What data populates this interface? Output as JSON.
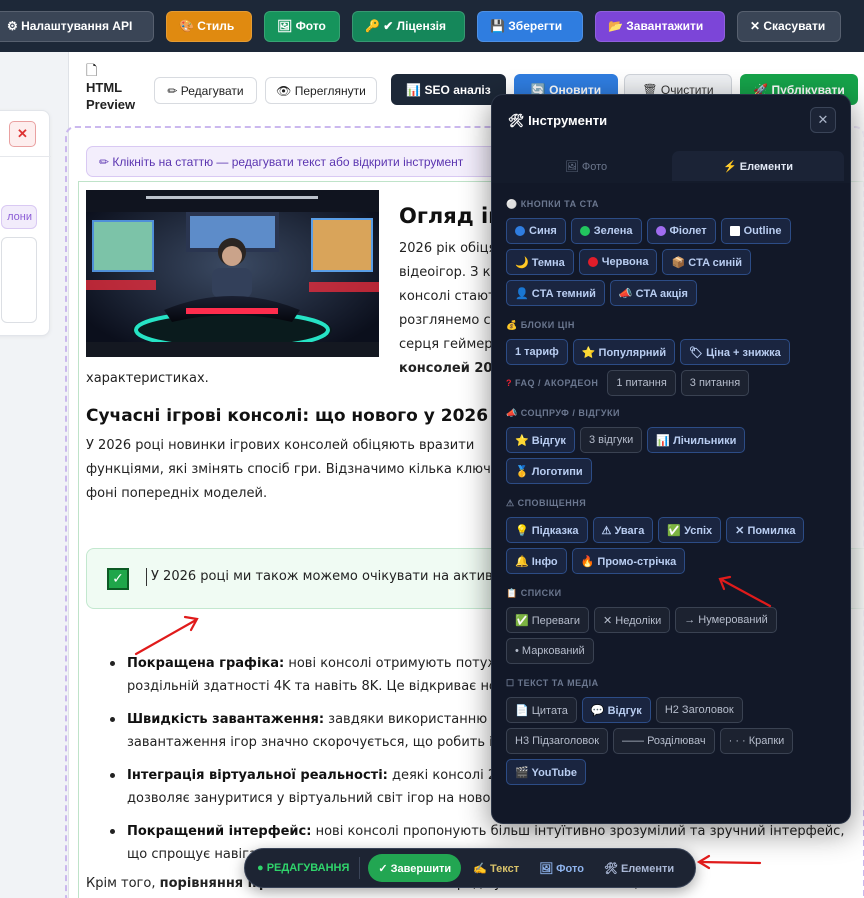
{
  "topbar": {
    "api": "⚙ Налаштування API",
    "style": "🎨 Стиль",
    "photo": "🖼 Фото",
    "license": "🔑 ✔ Ліцензія",
    "save": "💾 Зберегти",
    "load": "📂 Завантажити",
    "cancel": "✕ Скасувати"
  },
  "leftpanel": {
    "close": "✕",
    "pill": "лони"
  },
  "preview": {
    "title_line1": "HTML",
    "title_line2": "Preview",
    "edit": "✏ Редагувати",
    "view": "👁 Переглянути",
    "seo": "📊 SEO аналіз",
    "update": "🔄 Оновити",
    "clear": "🗑 Очистити",
    "publish": "🚀 Публікувати",
    "hint": "✏ Клікніть на статтю — редагувати текст або відкрити інструмент"
  },
  "article": {
    "h1": "Огляд іг",
    "intro": [
      "2026 рік обіця",
      "відеоігор. З ко",
      "консолі стают",
      "розглянемо с",
      "серця геймер",
      "консолей 202"
    ],
    "intro_cont": "характеристиках.",
    "h2": "Сучасні ігрові консолі: що нового у 2026 ро",
    "p1": [
      "У 2026 році новинки ігрових консолей обіцяють вразити",
      "функціями, які змінять спосіб гри. Відзначимо кілька ключо",
      "фоні попередніх моделей."
    ],
    "callout": "У 2026 році ми також можемо очікувати на активн",
    "bullets": [
      {
        "title": "Покращена графіка:",
        "line1": " нові консолі отримують потужн",
        "line2": "роздільній здатності 4K та навіть 8K. Це відкриває нов"
      },
      {
        "title": "Швидкість завантаження:",
        "line1": " завдяки використанню т",
        "line2": "завантаження ігор значно скорочується, що робить і"
      },
      {
        "title": "Інтеграція віртуальної реальності:",
        "line1": " деякі консолі 20",
        "line2": "дозволяє зануритися у віртуальний світ ігор на новом"
      },
      {
        "title": "Покращений інтерфейс:",
        "line1": " нові консолі пропонують більш інтуїтивно зрозумілий та зручний інтерфейс,",
        "line2": "що спрощує навіга"
      }
    ],
    "last_a": "Крім того, ",
    "last_b": "порівняння ігрових",
    "last_c": "                              ",
    "last_d": "зосереджуються на оптимізації"
  },
  "tools": {
    "title": "🛠 Інструменти",
    "close": "✕",
    "tab_photo": "🖼 Фото",
    "tab_elements": "⚡ Елементи",
    "sec_buttons": "КНОПКИ ТА CTA",
    "btn_blue": "Синя",
    "btn_green": "Зелена",
    "btn_violet": "Фіолет",
    "btn_outline": "Outline",
    "btn_dark": "🌙 Темна",
    "btn_red": "Червона",
    "btn_cta_blue": "📦 CTA синій",
    "btn_cta_dark": "👤 CTA темний",
    "btn_cta_promo": "📣 CTA акція",
    "sec_prices": "БЛОКИ ЦІН",
    "price_1": "1 тариф",
    "price_popular": "⭐ Популярний",
    "price_discount": "🏷 Ціна + знижка",
    "sec_faq": "FAQ / АКОРДЕОН",
    "faq_1": "1 питання",
    "faq_3": "3 питання",
    "sec_social": "СОЦПРУФ / ВІДГУКИ",
    "soc_review": "⭐ Відгук",
    "soc_3reviews": "3 відгуки",
    "soc_counters": "📊 Лічильники",
    "soc_logos": "🥇 Логотипи",
    "sec_notices": "СПОВІЩЕННЯ",
    "n_tip": "💡 Підказка",
    "n_warn": "⚠ Увага",
    "n_success": "✅ Успіх",
    "n_error": "✕ Помилка",
    "n_info": "🔔 Інфо",
    "n_promo": "🔥 Промо-стрічка",
    "sec_lists": "СПИСКИ",
    "l_pros": "✅ Переваги",
    "l_cons": "✕ Недоліки",
    "l_numbered": "→ Нумерований",
    "l_bulleted": "• Маркований",
    "sec_text": "ТЕКСТ ТА МЕДІА",
    "t_quote": "📄 Цитата",
    "t_review": "💬 Відгук",
    "t_h2": "H2 Заголовок",
    "t_h3": "H3 Підзаголовок",
    "t_divider": "—— Розділювач",
    "t_dots": "· · · Крапки",
    "t_youtube": "🎬 YouTube"
  },
  "bottombar": {
    "mode": "● РЕДАГУВАННЯ",
    "done": "✓ Завершити",
    "text": "✍ Текст",
    "photo": "🖼 Фото",
    "elements": "🛠 Елементи"
  },
  "colors": {
    "topbar_bg": "#1d2838",
    "style": "#e08a10",
    "photo": "#16945c",
    "save": "#2f7de0",
    "load": "#7c45d8",
    "tools_bg": "#141b2b",
    "annotation_arrow": "#e01b1b"
  }
}
